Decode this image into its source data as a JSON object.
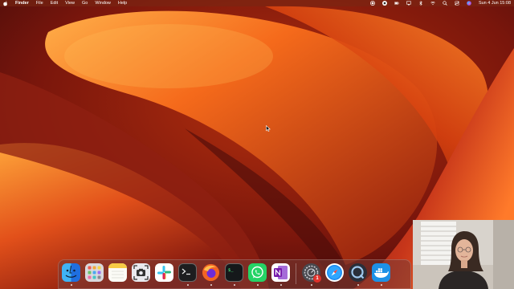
{
  "menubar": {
    "app_name": "Finder",
    "menus": [
      "File",
      "Edit",
      "View",
      "Go",
      "Window",
      "Help"
    ],
    "clock": "Sun 4 Jun  15:08",
    "status_icons": [
      "record-icon",
      "stop-icon",
      "battery-icon",
      "display-icon",
      "bluetooth-icon",
      "wifi-icon",
      "search-icon",
      "control-center-icon",
      "siri-icon"
    ]
  },
  "dock": {
    "apps": [
      {
        "name": "Finder",
        "icon": "finder-icon",
        "running": true
      },
      {
        "name": "Launchpad",
        "icon": "launchpad-icon",
        "running": false
      },
      {
        "name": "Notes",
        "icon": "notes-icon",
        "running": false
      },
      {
        "name": "Screenshot",
        "icon": "screenshot-icon",
        "running": false
      },
      {
        "name": "Slack",
        "icon": "slack-icon",
        "running": false
      },
      {
        "name": "Terminal",
        "icon": "terminal-icon",
        "running": true
      },
      {
        "name": "Firefox",
        "icon": "firefox-icon",
        "running": true
      },
      {
        "name": "iTerm",
        "icon": "iterm-icon",
        "running": true
      },
      {
        "name": "WhatsApp",
        "icon": "whatsapp-icon",
        "running": true
      },
      {
        "name": "OneNote",
        "icon": "onenote-icon",
        "running": true
      }
    ],
    "recent_apps": [
      {
        "name": "System Preferences",
        "icon": "settings-icon",
        "running": true,
        "badge": "1"
      },
      {
        "name": "Safari",
        "icon": "safari-icon",
        "running": false
      },
      {
        "name": "QuickTime Player",
        "icon": "quicktime-icon",
        "running": true
      },
      {
        "name": "Docker",
        "icon": "docker-icon",
        "running": true
      }
    ]
  },
  "colors": {
    "wallpaper_dark": "#3d0a0a",
    "wallpaper_orange": "#f56a1b",
    "wallpaper_glow": "#ffb04a",
    "dock_bg": "#7a3c37"
  }
}
